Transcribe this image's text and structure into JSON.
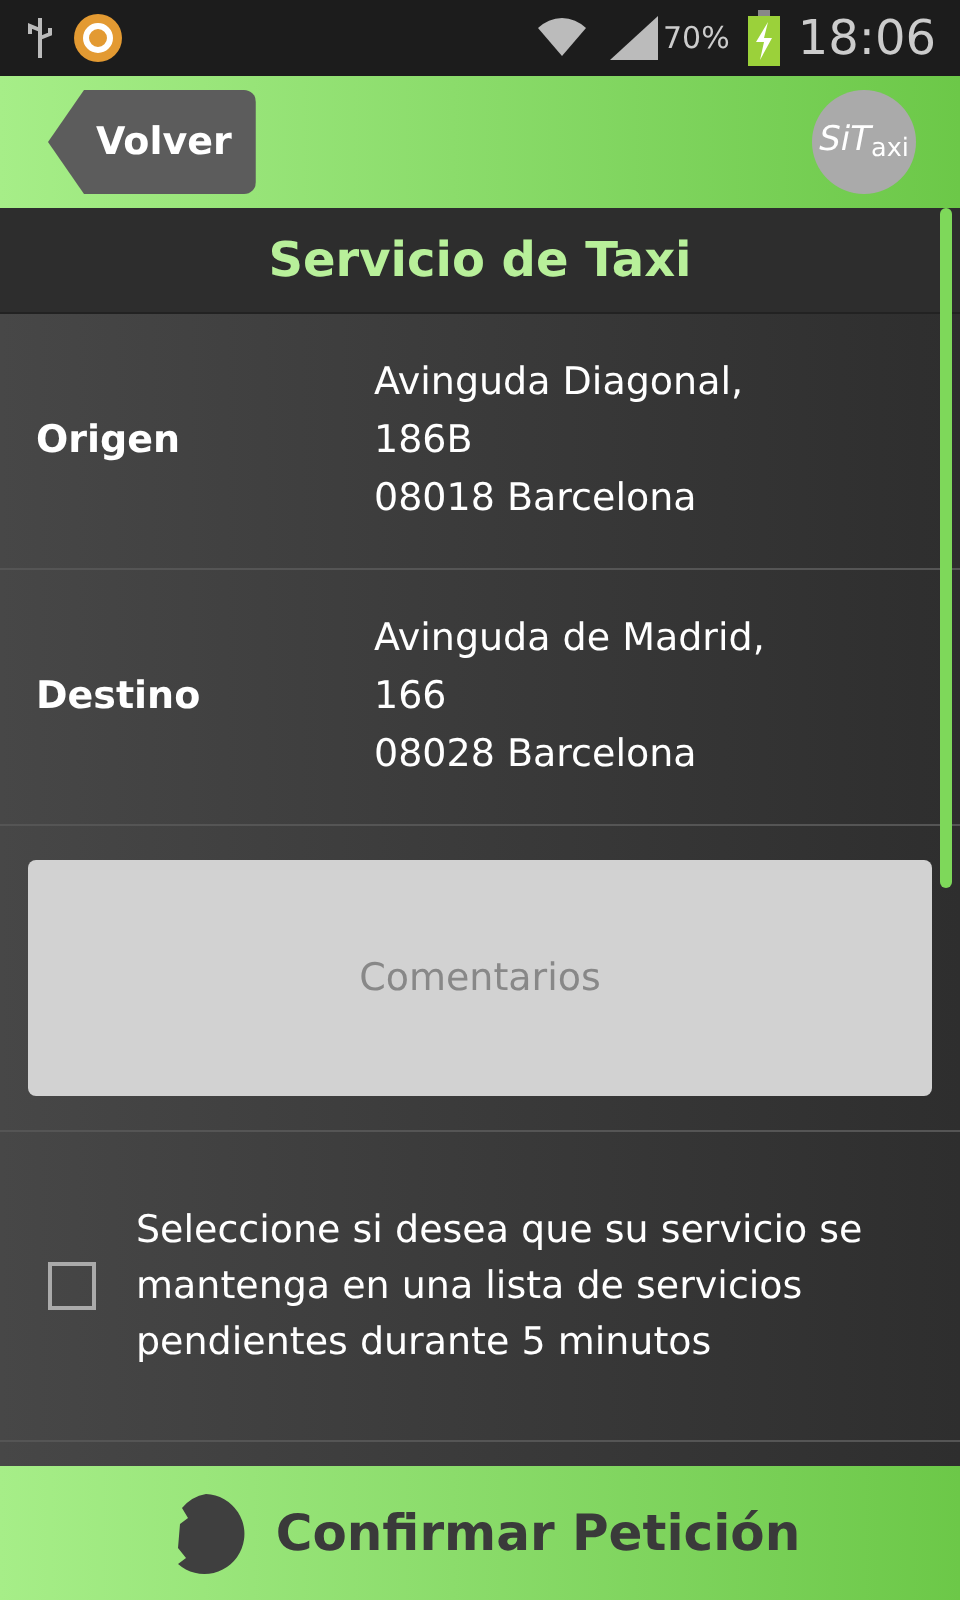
{
  "status_bar": {
    "battery_text": "70%",
    "time": "18:06"
  },
  "header": {
    "back_label": "Volver",
    "logo": "*SiT*$_{axi}$"
  },
  "title": "Servicio de Taxi",
  "addresses": [
    {
      "label": "Origen",
      "lines": [
        "Avinguda Diagonal,",
        "186B",
        "08018 Barcelona"
      ]
    },
    {
      "label": "Destino",
      "lines": [
        "Avinguda de Madrid,",
        "166",
        "08028 Barcelona"
      ]
    }
  ],
  "comments_button": {
    "label": "Comentarios"
  },
  "pending_option": {
    "text": "Seleccione si desea que su servicio se mantenga en una lista de servicios pendientes durante 5 minutos",
    "checked": false
  },
  "confirm_button": {
    "label": "Confirmar Petición"
  }
}
